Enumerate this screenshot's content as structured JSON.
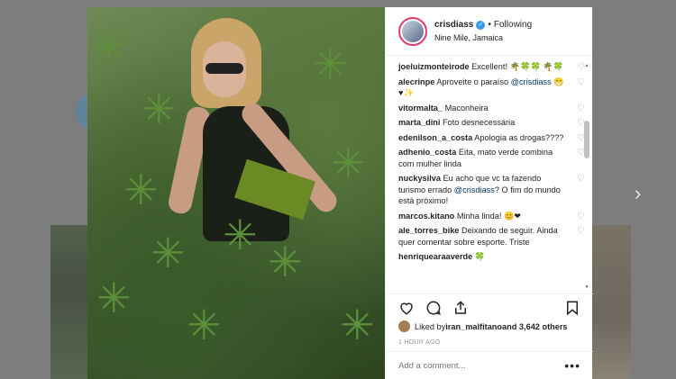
{
  "post": {
    "username": "crisdiass",
    "following": "Following",
    "dot": "•",
    "location": "Nine Mile, Jamaica"
  },
  "comments": [
    {
      "user": "joeluizmonteirode",
      "text": " Excellent! 🌴🍀🍀 🌴🍀"
    },
    {
      "user": "alecrinpe",
      "text": " Aproveite o paraíso ",
      "mention": "@crisdiass",
      "after": " 😁♥✨"
    },
    {
      "user": "vitormalta_",
      "text": " Maconheira"
    },
    {
      "user": "marta_dini",
      "text": " Foto desnecessária"
    },
    {
      "user": "edenilson_a_costa",
      "text": " Apologia as drogas????"
    },
    {
      "user": "adhenio_costa",
      "text": " Eita, mato verde combina com mulher linda"
    },
    {
      "user": "nuckysilva",
      "text": " Eu acho que vc ta fazendo turismo errado ",
      "mention": "@crisdiass",
      "after": "? O fim do mundo está próximo!"
    },
    {
      "user": "marcos.kitano",
      "text": " Minha linda! 😊❤"
    },
    {
      "user": "ale_torres_bike",
      "text": " Deixando de seguir. Ainda quer comentar sobre esporte. Triste"
    },
    {
      "user": "henriquearaaverde",
      "text": " 🍀"
    }
  ],
  "likes": {
    "prefix": "Liked by ",
    "user": "iran_malfitano",
    "suffix": " and 3,642 others"
  },
  "timestamp": "1 HOUR AGO",
  "add_comment_placeholder": "Add a comment...",
  "more_options": "•••",
  "next_arrow": "›",
  "icons": {
    "like": "heart-icon",
    "comment": "comment-icon",
    "share": "share-icon",
    "save": "bookmark-icon"
  },
  "colors": {
    "accent": "#3897f0",
    "story_ring": "#e23c6c",
    "mention": "#003569"
  }
}
